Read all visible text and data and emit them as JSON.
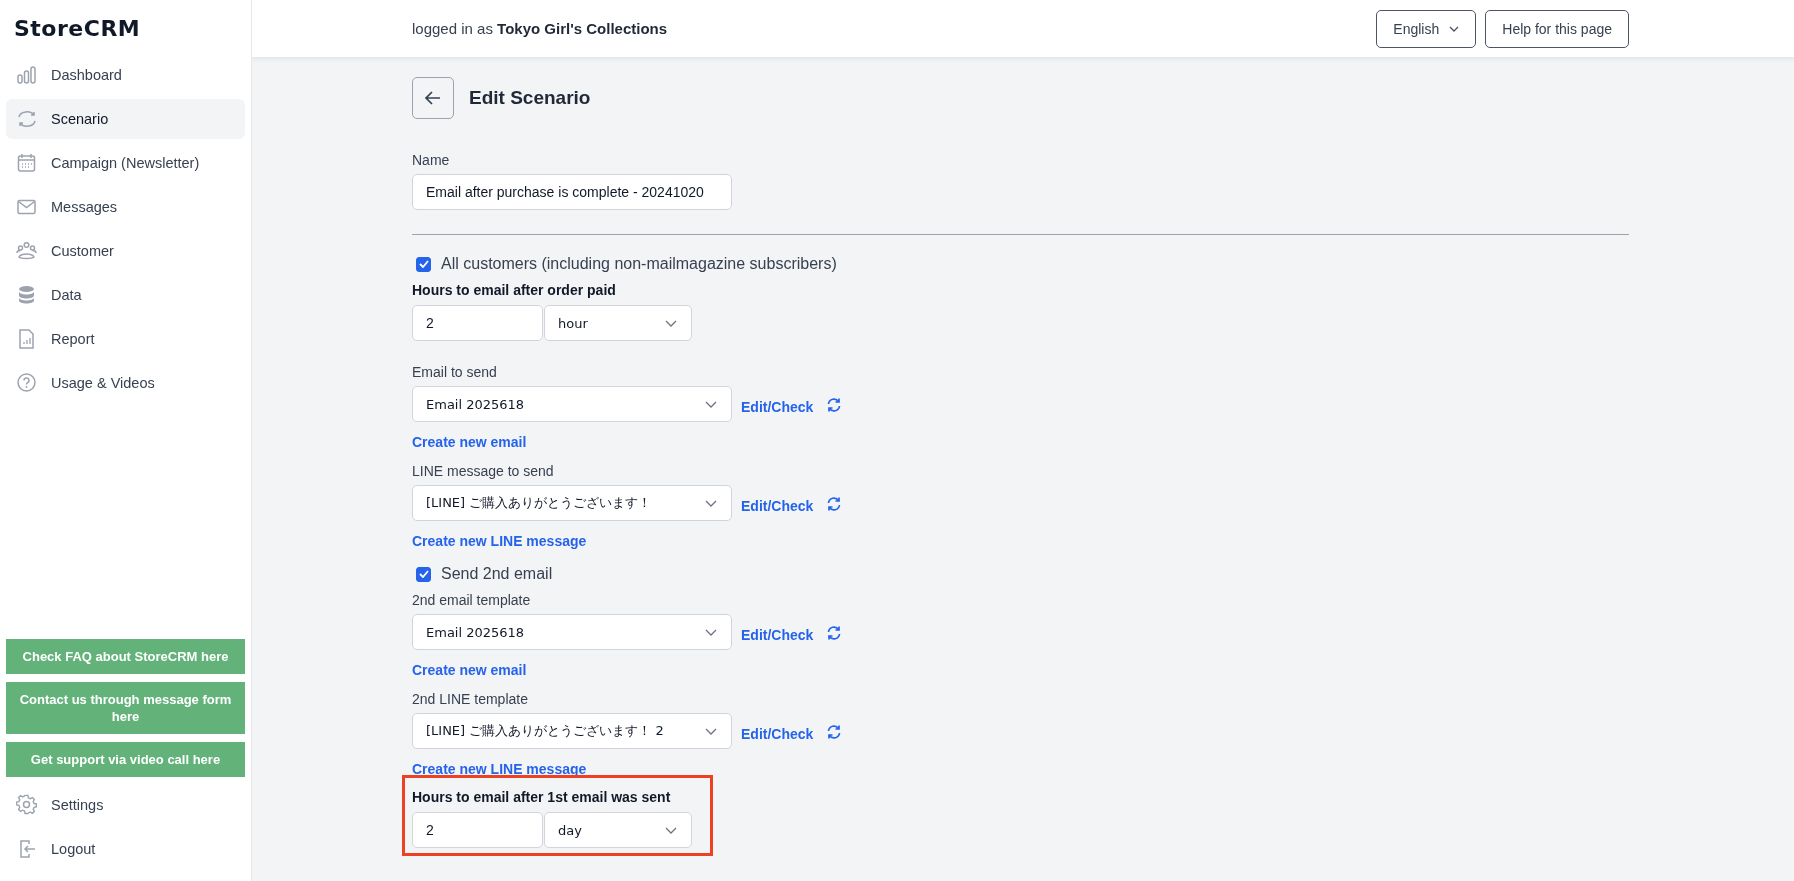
{
  "sidebar": {
    "logo": "StoreCRM",
    "items": [
      {
        "label": "Dashboard",
        "selected": false
      },
      {
        "label": "Scenario",
        "selected": true
      },
      {
        "label": "Campaign (Newsletter)",
        "selected": false
      },
      {
        "label": "Messages",
        "selected": false
      },
      {
        "label": "Customer",
        "selected": false
      },
      {
        "label": "Data",
        "selected": false
      },
      {
        "label": "Report",
        "selected": false
      },
      {
        "label": "Usage & Videos",
        "selected": false
      }
    ],
    "support_buttons": [
      "Check FAQ about StoreCRM here",
      "Contact us through message form here",
      "Get support via video call here"
    ],
    "bottom_items": [
      {
        "label": "Settings",
        "selected": false
      },
      {
        "label": "Logout",
        "selected": false
      }
    ]
  },
  "header": {
    "user": "logged in as **Tokyo Girl's Collections**",
    "language": "English",
    "help": "Help for this page"
  },
  "page": {
    "title": "Edit Scenario",
    "fields": [
      {
        "kind": "text",
        "label": "Name",
        "value": "Email after purchase is complete - 20241020"
      },
      {
        "kind": "divider"
      },
      {
        "kind": "checkbox",
        "label": "All customers (including non-mailmagazine subscribers)",
        "checked": true
      },
      {
        "kind": "duration",
        "label": "Hours to email after order paid",
        "value": "2",
        "unit": "hour",
        "highlighted": false
      },
      {
        "kind": "template",
        "label": "Email to send",
        "value": "Email 2025618",
        "action": "Edit/Check"
      },
      {
        "kind": "link",
        "text": "Create new email"
      },
      {
        "kind": "template",
        "label": "LINE message to send",
        "value": "[LINE] ご購入ありがとうございます！",
        "action": "Edit/Check"
      },
      {
        "kind": "link",
        "text": "Create new LINE message"
      },
      {
        "kind": "checkbox",
        "label": "Send 2nd email",
        "checked": true
      },
      {
        "kind": "template",
        "label": "2nd email template",
        "value": "Email 2025618",
        "action": "Edit/Check"
      },
      {
        "kind": "link",
        "text": "Create new email"
      },
      {
        "kind": "template",
        "label": "2nd LINE template",
        "value": "[LINE] ご購入ありがとうございます！ 2",
        "action": "Edit/Check"
      },
      {
        "kind": "link",
        "text": "Create new LINE message"
      },
      {
        "kind": "duration",
        "label": "Hours to email after 1st email was sent",
        "value": "2",
        "unit": "day",
        "highlighted": true
      }
    ]
  }
}
